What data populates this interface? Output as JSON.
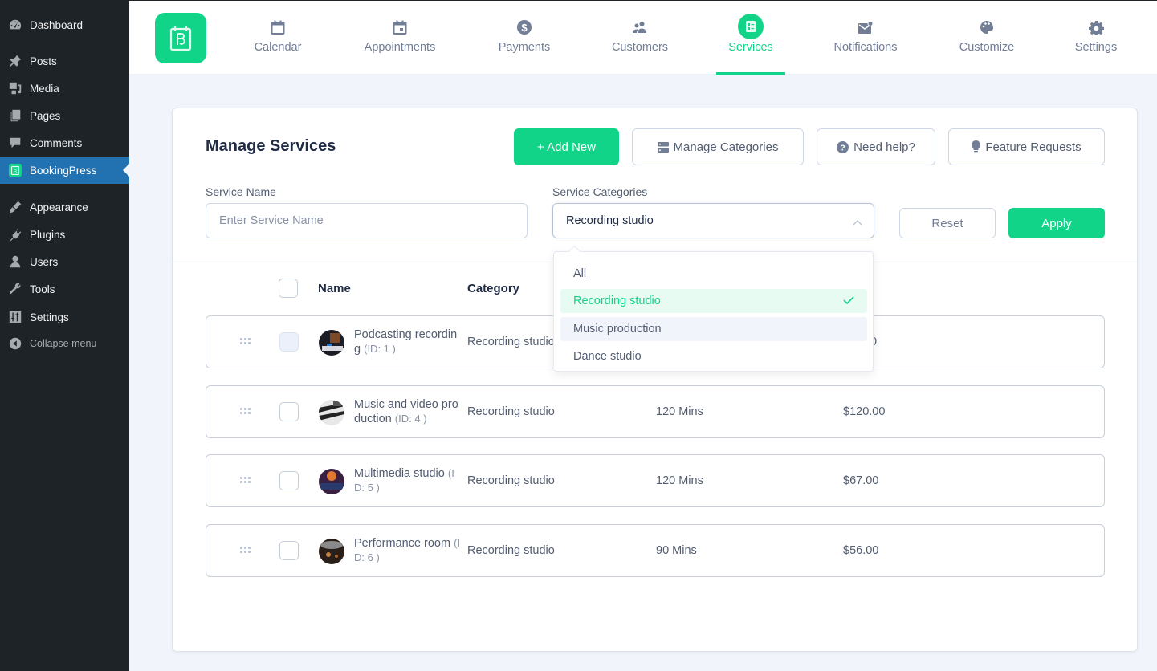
{
  "wp_sidebar": {
    "items": [
      {
        "label": "Dashboard",
        "icon": "dashboard-icon"
      },
      {
        "label": "Posts",
        "icon": "pin-icon"
      },
      {
        "label": "Media",
        "icon": "media-icon"
      },
      {
        "label": "Pages",
        "icon": "pages-icon"
      },
      {
        "label": "Comments",
        "icon": "comment-icon"
      },
      {
        "label": "BookingPress",
        "icon": "bookingpress-icon",
        "active": true
      },
      {
        "label": "Appearance",
        "icon": "brush-icon"
      },
      {
        "label": "Plugins",
        "icon": "plug-icon"
      },
      {
        "label": "Users",
        "icon": "user-icon"
      },
      {
        "label": "Tools",
        "icon": "wrench-icon"
      },
      {
        "label": "Settings",
        "icon": "sliders-icon"
      },
      {
        "label": "Collapse menu",
        "icon": "collapse-icon"
      }
    ]
  },
  "topnav": {
    "items": [
      {
        "label": "Calendar",
        "icon": "calendar-icon"
      },
      {
        "label": "Appointments",
        "icon": "appointment-icon"
      },
      {
        "label": "Payments",
        "icon": "dollar-icon"
      },
      {
        "label": "Customers",
        "icon": "customers-icon"
      },
      {
        "label": "Services",
        "icon": "services-icon",
        "active": true
      },
      {
        "label": "Notifications",
        "icon": "mail-icon"
      },
      {
        "label": "Customize",
        "icon": "palette-icon"
      },
      {
        "label": "Settings",
        "icon": "gear-icon"
      }
    ]
  },
  "page": {
    "title": "Manage Services",
    "buttons": {
      "add_new": "+ Add New",
      "manage_categories": "Manage Categories",
      "need_help": "Need help?",
      "feature_requests": "Feature Requests"
    }
  },
  "filters": {
    "service_name_label": "Service Name",
    "service_name_placeholder": "Enter Service Name",
    "service_name_value": "",
    "categories_label": "Service Categories",
    "categories_value": "Recording studio",
    "reset_label": "Reset",
    "apply_label": "Apply"
  },
  "dropdown": {
    "options": [
      {
        "label": "All"
      },
      {
        "label": "Recording studio",
        "selected": true
      },
      {
        "label": "Music production",
        "hovered": true
      },
      {
        "label": "Dance studio"
      }
    ]
  },
  "table": {
    "headers": {
      "name": "Name",
      "category": "Category"
    },
    "rows": [
      {
        "name": "Podcasting recording",
        "id": "(ID: 1 )",
        "category": "Recording studio",
        "duration": "",
        "price": "0"
      },
      {
        "name": "Music and video production",
        "id": "(ID: 4 )",
        "category": "Recording studio",
        "duration": "120 Mins",
        "price": "$120.00"
      },
      {
        "name": "Multimedia studio",
        "id": "(ID: 5 )",
        "category": "Recording studio",
        "duration": "120 Mins",
        "price": "$67.00"
      },
      {
        "name": "Performance room",
        "id": "(ID: 6 )",
        "category": "Recording studio",
        "duration": "90 Mins",
        "price": "$56.00"
      }
    ]
  },
  "colors": {
    "accent": "#12d488",
    "wp_sidebar_bg": "#1d2327",
    "wp_active": "#2271b1"
  }
}
